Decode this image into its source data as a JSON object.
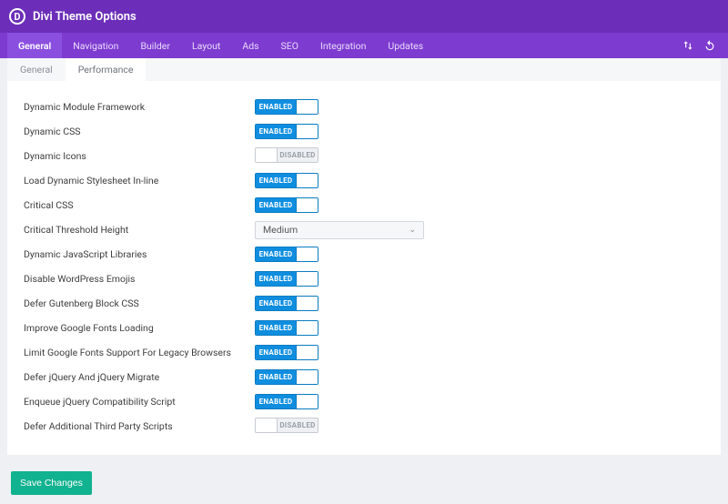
{
  "header": {
    "logo_letter": "D",
    "title": "Divi Theme Options"
  },
  "nav": {
    "tabs": [
      "General",
      "Navigation",
      "Builder",
      "Layout",
      "Ads",
      "SEO",
      "Integration",
      "Updates"
    ],
    "active_index": 0
  },
  "subnav": {
    "tabs": [
      "General",
      "Performance"
    ],
    "active_index": 1
  },
  "toggle_labels": {
    "enabled": "ENABLED",
    "disabled": "DISABLED"
  },
  "settings": [
    {
      "label": "Dynamic Module Framework",
      "type": "toggle",
      "value": "enabled"
    },
    {
      "label": "Dynamic CSS",
      "type": "toggle",
      "value": "enabled"
    },
    {
      "label": "Dynamic Icons",
      "type": "toggle",
      "value": "disabled"
    },
    {
      "label": "Load Dynamic Stylesheet In-line",
      "type": "toggle",
      "value": "enabled"
    },
    {
      "label": "Critical CSS",
      "type": "toggle",
      "value": "enabled"
    },
    {
      "label": "Critical Threshold Height",
      "type": "select",
      "value": "Medium"
    },
    {
      "label": "Dynamic JavaScript Libraries",
      "type": "toggle",
      "value": "enabled"
    },
    {
      "label": "Disable WordPress Emojis",
      "type": "toggle",
      "value": "enabled"
    },
    {
      "label": "Defer Gutenberg Block CSS",
      "type": "toggle",
      "value": "enabled"
    },
    {
      "label": "Improve Google Fonts Loading",
      "type": "toggle",
      "value": "enabled"
    },
    {
      "label": "Limit Google Fonts Support For Legacy Browsers",
      "type": "toggle",
      "value": "enabled"
    },
    {
      "label": "Defer jQuery And jQuery Migrate",
      "type": "toggle",
      "value": "enabled"
    },
    {
      "label": "Enqueue jQuery Compatibility Script",
      "type": "toggle",
      "value": "enabled"
    },
    {
      "label": "Defer Additional Third Party Scripts",
      "type": "toggle",
      "value": "disabled"
    }
  ],
  "save_button": "Save Changes"
}
